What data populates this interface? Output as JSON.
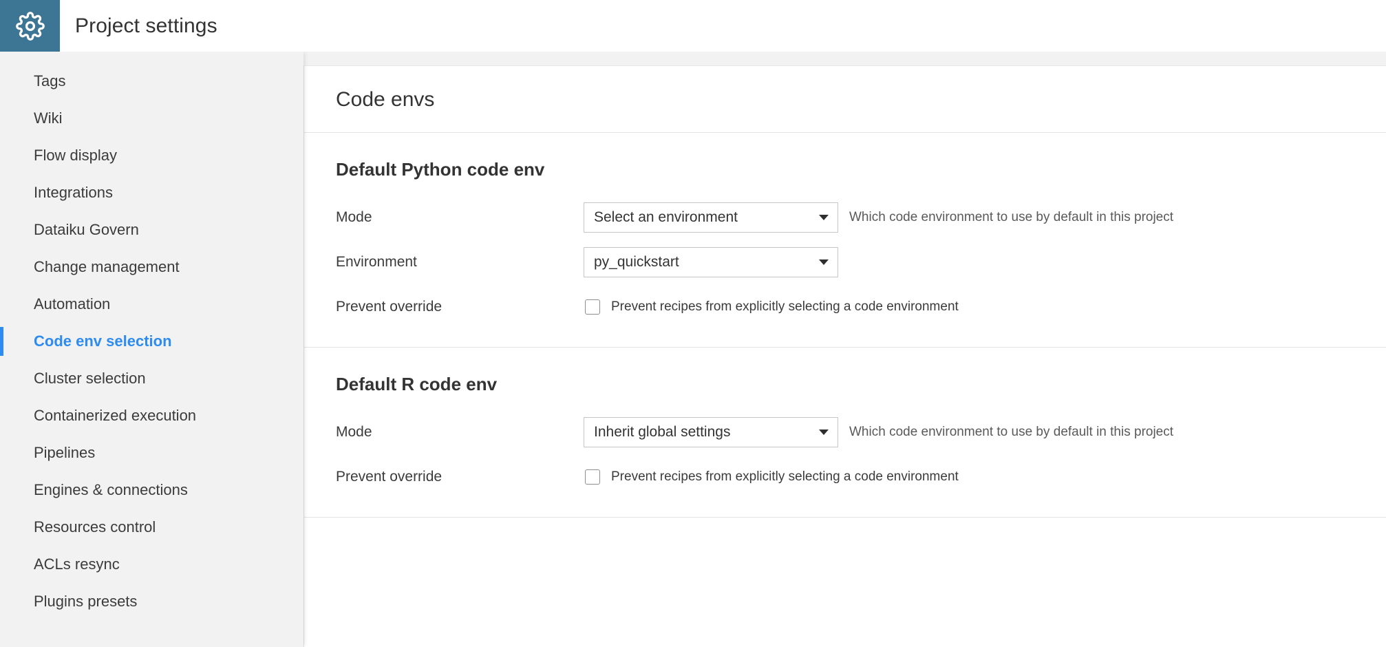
{
  "header": {
    "icon": "gear-icon",
    "title": "Project settings",
    "icon_bg_color": "#3d7694"
  },
  "sidebar": {
    "active_color": "#2e8bef",
    "items": [
      {
        "label": "Tags",
        "active": false
      },
      {
        "label": "Wiki",
        "active": false
      },
      {
        "label": "Flow display",
        "active": false
      },
      {
        "label": "Integrations",
        "active": false
      },
      {
        "label": "Dataiku Govern",
        "active": false
      },
      {
        "label": "Change management",
        "active": false
      },
      {
        "label": "Automation",
        "active": false
      },
      {
        "label": "Code env selection",
        "active": true
      },
      {
        "label": "Cluster selection",
        "active": false
      },
      {
        "label": "Containerized execution",
        "active": false
      },
      {
        "label": "Pipelines",
        "active": false
      },
      {
        "label": "Engines & connections",
        "active": false
      },
      {
        "label": "Resources control",
        "active": false
      },
      {
        "label": "ACLs resync",
        "active": false
      },
      {
        "label": "Plugins presets",
        "active": false
      }
    ]
  },
  "main": {
    "title": "Code envs",
    "python_section": {
      "heading": "Default Python code env",
      "mode_label": "Mode",
      "mode_value": "Select an environment",
      "mode_hint": "Which code environment to use by default in this project",
      "environment_label": "Environment",
      "environment_value": "py_quickstart",
      "prevent_override_label": "Prevent override",
      "prevent_override_checkbox_label": "Prevent recipes from explicitly selecting a code environment",
      "prevent_override_checked": false
    },
    "r_section": {
      "heading": "Default R code env",
      "mode_label": "Mode",
      "mode_value": "Inherit global settings",
      "mode_hint": "Which code environment to use by default in this project",
      "prevent_override_label": "Prevent override",
      "prevent_override_checkbox_label": "Prevent recipes from explicitly selecting a code environment",
      "prevent_override_checked": false
    }
  }
}
